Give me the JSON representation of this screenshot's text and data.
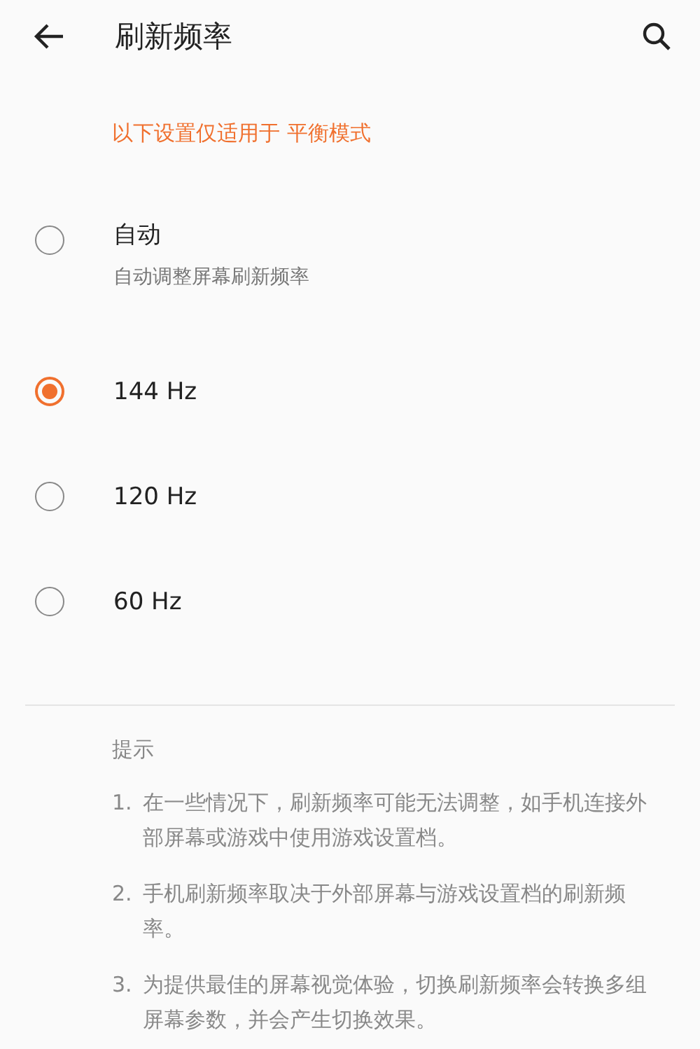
{
  "header": {
    "title": "刷新频率"
  },
  "note": "以下设置仅适用于 平衡模式",
  "options": [
    {
      "label": "自动",
      "subtitle": "自动调整屏幕刷新频率",
      "selected": false
    },
    {
      "label": "144 Hz",
      "selected": true
    },
    {
      "label": "120 Hz",
      "selected": false
    },
    {
      "label": "60 Hz",
      "selected": false
    }
  ],
  "tips": {
    "title": "提示",
    "items": [
      {
        "number": "1.",
        "text": "在一些情况下，刷新频率可能无法调整，如手机连接外部屏幕或游戏中使用游戏设置档。"
      },
      {
        "number": "2.",
        "text": "手机刷新频率取决于外部屏幕与游戏设置档的刷新频率。"
      },
      {
        "number": "3.",
        "text": "为提供最佳的屏幕视觉体验，切换刷新频率会转换多组屏幕参数，并会产生切换效果。"
      }
    ]
  }
}
